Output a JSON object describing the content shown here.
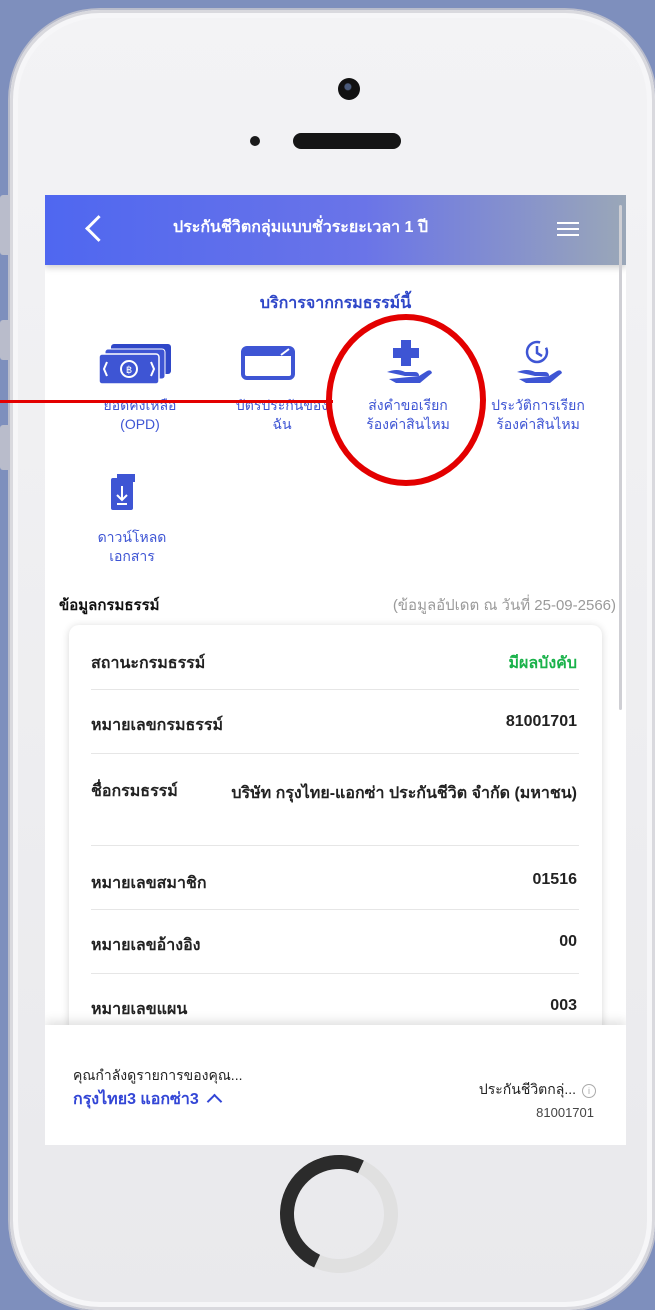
{
  "header": {
    "title": "ประกันชีวิตกลุ่มแบบชั่วระยะเวลา 1 ปี"
  },
  "services": {
    "title": "บริการจากกรมธรรม์นี้",
    "items": [
      {
        "label": "ยอดคงเหลือ (OPD)",
        "icon": "money-icon"
      },
      {
        "label": "บัตรประกันของฉัน",
        "icon": "card-icon"
      },
      {
        "label": "ส่งคำขอเรียกร้องค่าสินไหม",
        "icon": "medical-hand-icon"
      },
      {
        "label": "ประวัติการเรียกร้องค่าสินไหม",
        "icon": "history-hand-icon"
      },
      {
        "label": "ดาวน์โหลดเอกสาร",
        "icon": "download-document-icon"
      }
    ]
  },
  "policy_info": {
    "title": "ข้อมูลกรมธรรม์",
    "updated": "(ข้อมูลอัปเดต ณ วันที่ 25-09-2566)",
    "rows": [
      {
        "label": "สถานะกรมธรรม์",
        "value": "มีผลบังคับ"
      },
      {
        "label": "หมายเลขกรมธรรม์",
        "value": "81001701"
      },
      {
        "label": "ชื่อกรมธรรม์",
        "value": "บริษัท กรุงไทย-แอกซ่า ประกันชีวิต จำกัด (มหาชน)"
      },
      {
        "label": "หมายเลขสมาชิก",
        "value": "01516"
      },
      {
        "label": "หมายเลขอ้างอิง",
        "value": "00"
      },
      {
        "label": "หมายเลขแผน",
        "value": "003"
      }
    ]
  },
  "bottom": {
    "viewing_text": "คุณกำลังดูรายการของคุณ...",
    "company": "กรุงไทย3 แอกซ่า3",
    "plan_name": "ประกันชีวิตกลุ่...",
    "plan_number": "81001701"
  },
  "colors": {
    "accent": "#3e55d4",
    "active_status": "#19b24a",
    "highlight": "#e30000"
  }
}
